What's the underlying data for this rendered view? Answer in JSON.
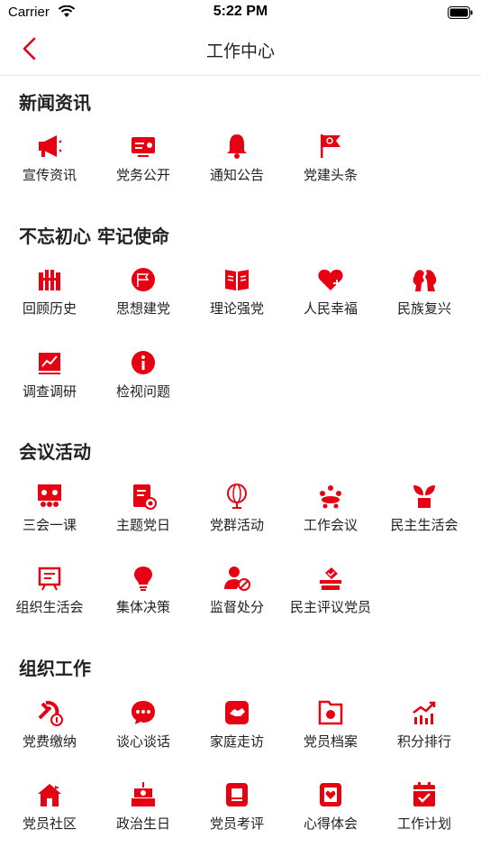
{
  "status_bar": {
    "carrier": "Carrier",
    "time": "5:22 PM"
  },
  "nav": {
    "title": "工作中心"
  },
  "accent_color": "#e60012",
  "sections": [
    {
      "title": "新闻资讯",
      "items": [
        {
          "label": "宣传资讯",
          "icon": "megaphone-icon"
        },
        {
          "label": "党务公开",
          "icon": "party-card-icon"
        },
        {
          "label": "通知公告",
          "icon": "bell-icon"
        },
        {
          "label": "党建头条",
          "icon": "party-flag-icon"
        }
      ]
    },
    {
      "title": "不忘初心 牢记使命",
      "items": [
        {
          "label": "回顾历史",
          "icon": "great-wall-icon"
        },
        {
          "label": "思想建党",
          "icon": "flag-circle-icon"
        },
        {
          "label": "理论强党",
          "icon": "open-book-icon"
        },
        {
          "label": "人民幸福",
          "icon": "heart-plus-icon"
        },
        {
          "label": "民族复兴",
          "icon": "head-profiles-icon"
        },
        {
          "label": "调查调研",
          "icon": "chart-trend-icon"
        },
        {
          "label": "检视问题",
          "icon": "info-icon"
        }
      ]
    },
    {
      "title": "会议活动",
      "items": [
        {
          "label": "三会一课",
          "icon": "meeting-board-icon"
        },
        {
          "label": "主题党日",
          "icon": "document-emblem-icon"
        },
        {
          "label": "党群活动",
          "icon": "lantern-icon"
        },
        {
          "label": "工作会议",
          "icon": "people-table-icon"
        },
        {
          "label": "民主生活会",
          "icon": "sprout-icon"
        },
        {
          "label": "组织生活会",
          "icon": "board-easel-icon"
        },
        {
          "label": "集体决策",
          "icon": "lightbulb-icon"
        },
        {
          "label": "监督处分",
          "icon": "user-ban-icon"
        },
        {
          "label": "民主评议党员",
          "icon": "ballot-box-icon"
        }
      ]
    },
    {
      "title": "组织工作",
      "items": [
        {
          "label": "党费缴纳",
          "icon": "emblem-coin-icon"
        },
        {
          "label": "谈心谈话",
          "icon": "chat-bubble-icon"
        },
        {
          "label": "家庭走访",
          "icon": "handshake-icon"
        },
        {
          "label": "党员档案",
          "icon": "folder-emblem-icon"
        },
        {
          "label": "积分排行",
          "icon": "bar-trend-icon"
        },
        {
          "label": "党员社区",
          "icon": "house-flag-icon"
        },
        {
          "label": "政治生日",
          "icon": "cake-emblem-icon"
        },
        {
          "label": "党员考评",
          "icon": "laptop-icon"
        },
        {
          "label": "心得体会",
          "icon": "card-heart-icon"
        },
        {
          "label": "工作计划",
          "icon": "calendar-check-icon"
        }
      ]
    }
  ]
}
